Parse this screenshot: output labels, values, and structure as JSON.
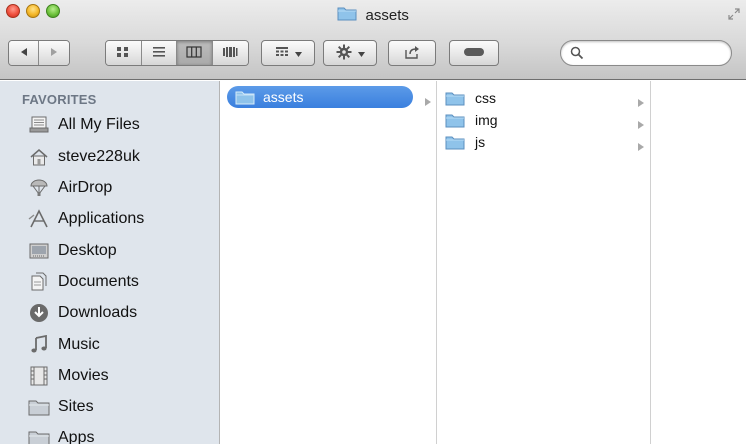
{
  "window": {
    "title": "assets"
  },
  "toolbar": {
    "back_icon": "back-arrow-icon",
    "forward_icon": "forward-arrow-icon",
    "view_icons": [
      "icon-view-icon",
      "list-view-icon",
      "column-view-icon",
      "cover-flow-view-icon"
    ],
    "active_view": "column-view-icon",
    "arrange_icon": "arrange-grid-icon",
    "action_icon": "gear-icon",
    "share_icon": "share-icon",
    "tags_icon": "tag-toggle-icon",
    "search": {
      "value": "",
      "placeholder": ""
    }
  },
  "sidebar": {
    "header": "FAVORITES",
    "items": [
      {
        "label": "All My Files",
        "icon": "all-files-icon"
      },
      {
        "label": "steve228uk",
        "icon": "home-icon"
      },
      {
        "label": "AirDrop",
        "icon": "airdrop-icon"
      },
      {
        "label": "Applications",
        "icon": "applications-icon"
      },
      {
        "label": "Desktop",
        "icon": "desktop-icon"
      },
      {
        "label": "Documents",
        "icon": "documents-icon"
      },
      {
        "label": "Downloads",
        "icon": "downloads-icon"
      },
      {
        "label": "Music",
        "icon": "music-icon"
      },
      {
        "label": "Movies",
        "icon": "movies-icon"
      },
      {
        "label": "Sites",
        "icon": "folder-icon"
      },
      {
        "label": "Apps",
        "icon": "folder-icon"
      }
    ]
  },
  "columns": [
    {
      "items": [
        {
          "label": "assets",
          "selected": true,
          "has_children": true
        }
      ]
    },
    {
      "items": [
        {
          "label": "css",
          "selected": false,
          "has_children": true
        },
        {
          "label": "img",
          "selected": false,
          "has_children": true
        },
        {
          "label": "js",
          "selected": false,
          "has_children": true
        }
      ]
    },
    {
      "items": []
    }
  ],
  "colors": {
    "selection": "#3a7fde",
    "sidebar_bg": "#dfe5ec",
    "folder_blue": "#8fc3ea"
  }
}
